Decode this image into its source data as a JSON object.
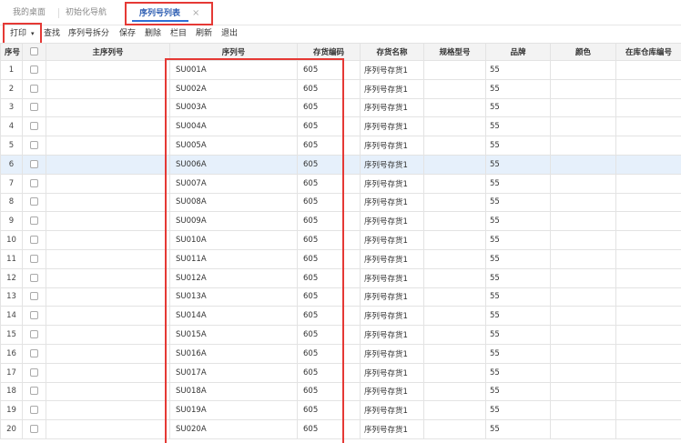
{
  "tabs": {
    "home": "我的桌面",
    "guide": "初始化导航",
    "active": "序列号列表",
    "close_glyph": "×"
  },
  "toolbar": {
    "print": "打印",
    "find": "查找",
    "split": "序列号拆分",
    "save": "保存",
    "delete": "删除",
    "columns": "栏目",
    "refresh": "刷新",
    "exit": "退出"
  },
  "table": {
    "headers": {
      "idx": "序号",
      "main_sn": "主序列号",
      "sn": "序列号",
      "code": "存货编码",
      "name": "存货名称",
      "spec": "规格型号",
      "brand": "品牌",
      "color": "颜色",
      "warehouse": "在库仓库编号"
    },
    "highlight_row": 6,
    "rows": [
      {
        "idx": "1",
        "sn": "SU001A",
        "code": "605",
        "name": "序列号存货1",
        "brand": "55"
      },
      {
        "idx": "2",
        "sn": "SU002A",
        "code": "605",
        "name": "序列号存货1",
        "brand": "55"
      },
      {
        "idx": "3",
        "sn": "SU003A",
        "code": "605",
        "name": "序列号存货1",
        "brand": "55"
      },
      {
        "idx": "4",
        "sn": "SU004A",
        "code": "605",
        "name": "序列号存货1",
        "brand": "55"
      },
      {
        "idx": "5",
        "sn": "SU005A",
        "code": "605",
        "name": "序列号存货1",
        "brand": "55"
      },
      {
        "idx": "6",
        "sn": "SU006A",
        "code": "605",
        "name": "序列号存货1",
        "brand": "55"
      },
      {
        "idx": "7",
        "sn": "SU007A",
        "code": "605",
        "name": "序列号存货1",
        "brand": "55"
      },
      {
        "idx": "8",
        "sn": "SU008A",
        "code": "605",
        "name": "序列号存货1",
        "brand": "55"
      },
      {
        "idx": "9",
        "sn": "SU009A",
        "code": "605",
        "name": "序列号存货1",
        "brand": "55"
      },
      {
        "idx": "10",
        "sn": "SU010A",
        "code": "605",
        "name": "序列号存货1",
        "brand": "55"
      },
      {
        "idx": "11",
        "sn": "SU011A",
        "code": "605",
        "name": "序列号存货1",
        "brand": "55"
      },
      {
        "idx": "12",
        "sn": "SU012A",
        "code": "605",
        "name": "序列号存货1",
        "brand": "55"
      },
      {
        "idx": "13",
        "sn": "SU013A",
        "code": "605",
        "name": "序列号存货1",
        "brand": "55"
      },
      {
        "idx": "14",
        "sn": "SU014A",
        "code": "605",
        "name": "序列号存货1",
        "brand": "55"
      },
      {
        "idx": "15",
        "sn": "SU015A",
        "code": "605",
        "name": "序列号存货1",
        "brand": "55"
      },
      {
        "idx": "16",
        "sn": "SU016A",
        "code": "605",
        "name": "序列号存货1",
        "brand": "55"
      },
      {
        "idx": "17",
        "sn": "SU017A",
        "code": "605",
        "name": "序列号存货1",
        "brand": "55"
      },
      {
        "idx": "18",
        "sn": "SU018A",
        "code": "605",
        "name": "序列号存货1",
        "brand": "55"
      },
      {
        "idx": "19",
        "sn": "SU019A",
        "code": "605",
        "name": "序列号存货1",
        "brand": "55"
      },
      {
        "idx": "20",
        "sn": "SU020A",
        "code": "605",
        "name": "序列号存货1",
        "brand": "55"
      }
    ]
  },
  "colors": {
    "accent": "#2f6fd6",
    "annotation_red": "#e53935",
    "row_highlight": "#e6f0fb"
  }
}
